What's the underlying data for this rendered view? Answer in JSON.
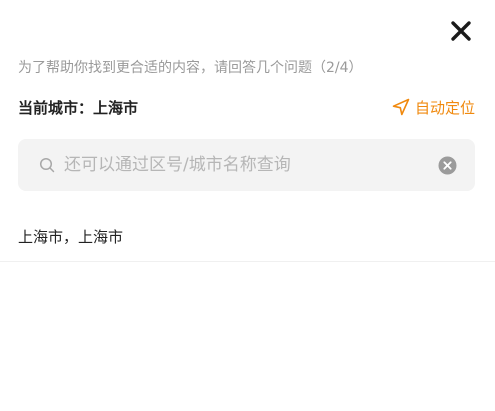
{
  "header": {
    "close_icon": "close-icon",
    "hint": "为了帮助你找到更合适的内容，请回答几个问题（2/4）"
  },
  "city": {
    "current": "当前城市：上海市",
    "locate_label": "自动定位",
    "locate_icon": "navigation-arrow-icon",
    "accent_color": "#f0890e"
  },
  "search": {
    "value": "",
    "placeholder": "还可以通过区号/城市名称查询",
    "search_icon": "search-icon",
    "clear_icon": "clear-icon"
  },
  "results": [
    {
      "label": "上海市，上海市"
    }
  ]
}
